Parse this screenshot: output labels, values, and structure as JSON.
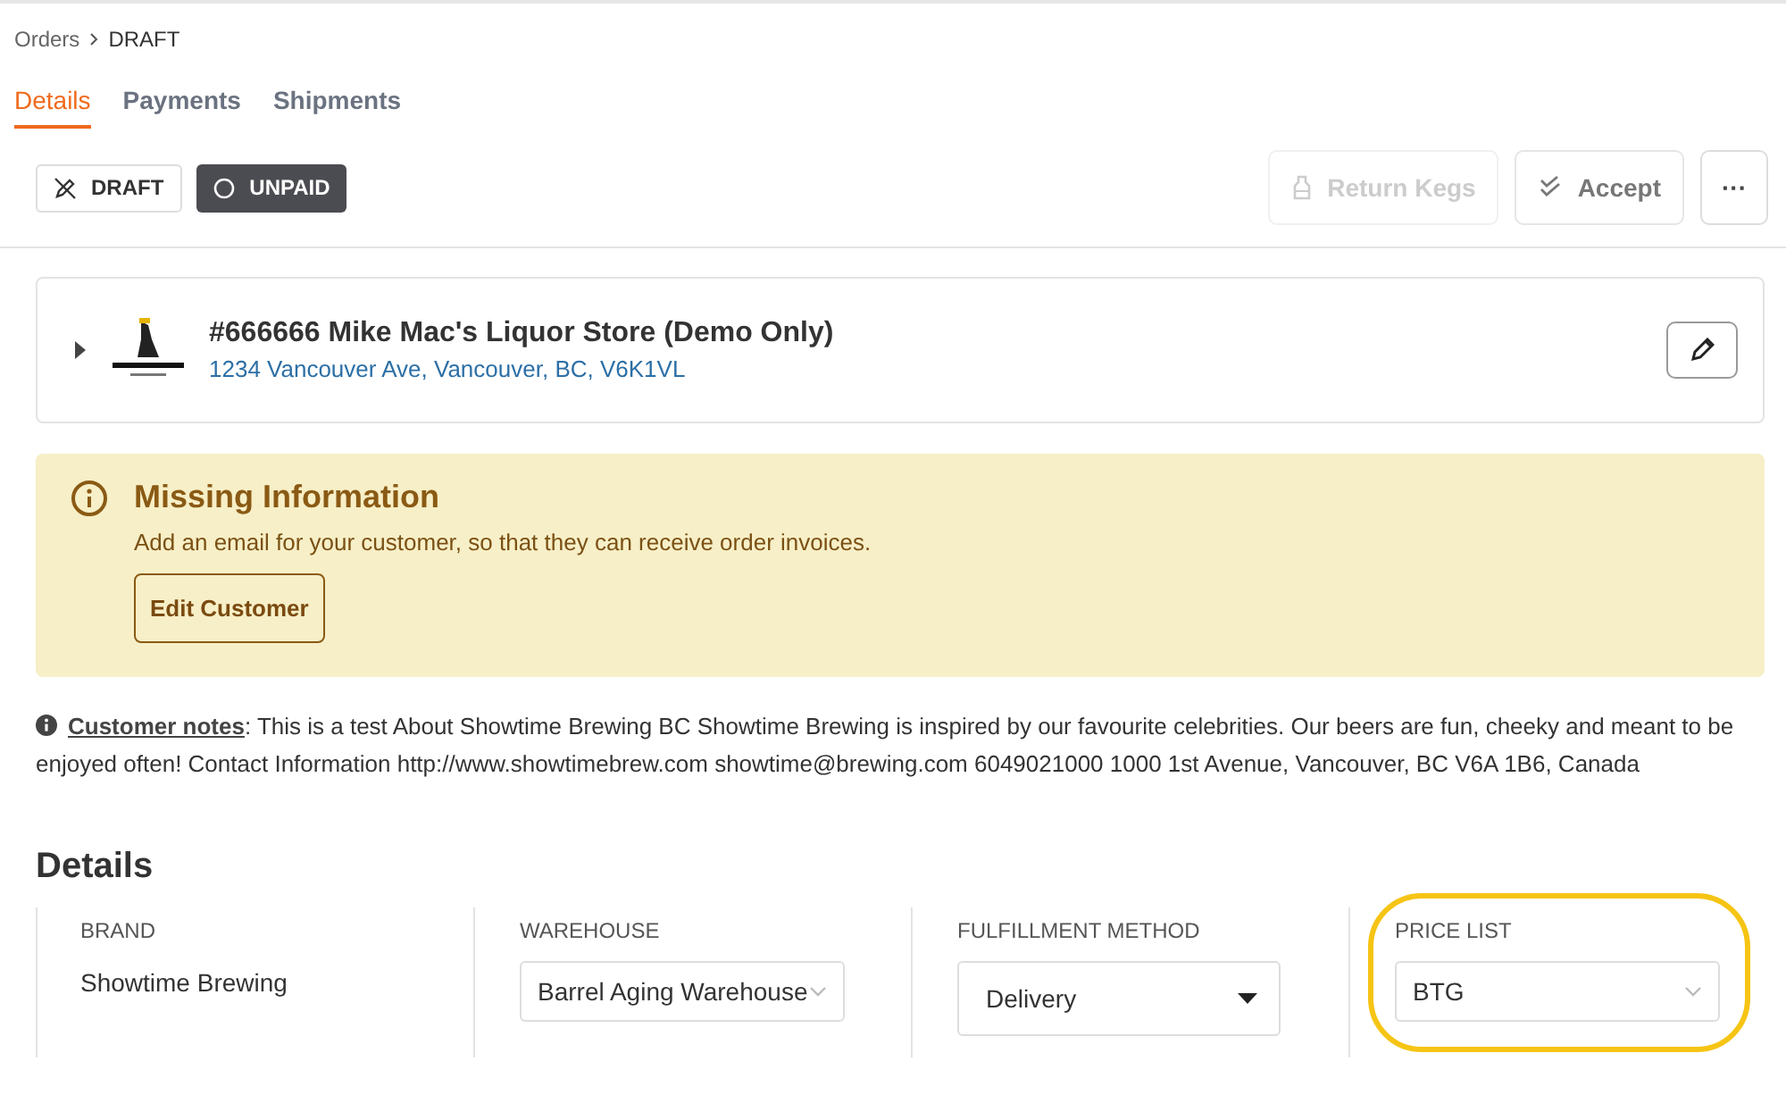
{
  "breadcrumb": [
    {
      "label": "Orders",
      "current": false
    },
    {
      "label": "DRAFT",
      "current": true
    }
  ],
  "tabs": [
    {
      "label": "Details",
      "selected": true
    },
    {
      "label": "Payments",
      "selected": false
    },
    {
      "label": "Shipments",
      "selected": false
    }
  ],
  "status_chips": [
    {
      "label": "DRAFT",
      "kind": "draft"
    },
    {
      "label": "UNPAID",
      "kind": "unpaid"
    }
  ],
  "actions": [
    {
      "label": "Return Kegs",
      "kind": "kegs",
      "disabled": true
    },
    {
      "label": "Accept",
      "kind": "accept",
      "disabled": false
    },
    {
      "label": "···",
      "kind": "more",
      "disabled": false
    }
  ],
  "customer": {
    "name": "#666666 Mike Mac's Liquor Store (Demo Only)",
    "address": "1234 Vancouver Ave, Vancouver, BC, V6K1VL",
    "expanded": false
  },
  "alert": {
    "title": "Missing Information",
    "message": "Add an email for your customer, so that they can receive order invoices.",
    "button": "Edit Customer"
  },
  "notes": {
    "label": "Customer notes",
    "text": ": This is a test About Showtime Brewing BC Showtime Brewing is inspired by our favourite celebrities. Our beers are fun, cheeky and meant to be enjoyed often! Contact Information http://www.showtimebrew.com showtime@brewing.com 6049021000 1000 1st Avenue, Vancouver, BC V6A 1B6, Canada"
  },
  "details": {
    "title": "Details",
    "fields": [
      {
        "label": "BRAND",
        "kind": "text",
        "value": "Showtime Brewing",
        "highlighted": false
      },
      {
        "label": "WAREHOUSE",
        "kind": "select",
        "value": "Barrel Aging Warehouse",
        "highlighted": false
      },
      {
        "label": "FULFILLMENT METHOD",
        "kind": "dropdown",
        "value": "Delivery",
        "highlighted": false
      },
      {
        "label": "PRICE LIST",
        "kind": "select",
        "value": "BTG",
        "highlighted": true
      }
    ]
  }
}
